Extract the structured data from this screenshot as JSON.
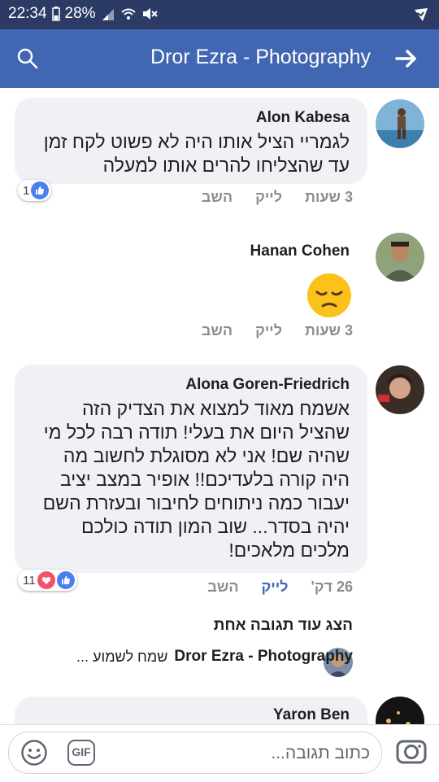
{
  "status_bar": {
    "time": "22:34",
    "battery": "28%"
  },
  "header": {
    "title": "Dror Ezra - Photography"
  },
  "comments": [
    {
      "author": "Alon Kabesa",
      "lines": [
        "לגמריי הציל אותו היה לא פשוט לקח זמן",
        "עד שהצליחו להרים אותו למעלה"
      ],
      "time": "3 שעות",
      "like_label": "לייק",
      "reply_label": "השב",
      "reaction_count": "1"
    },
    {
      "author": "Hanan Cohen",
      "emoji": "😔",
      "time": "3 שעות",
      "like_label": "לייק",
      "reply_label": "השב"
    },
    {
      "author": "Alona Goren-Friedrich",
      "lines": [
        "אשמח מאוד למצוא את הצדיק הזה",
        "שהציל היום את בעלי! תודה רבה לכל מי",
        "שהיה שם! אני לא מסוגלת לחשוב מה",
        "היה קורה בלעדיכם!! אופיר במצב יציב",
        "יעבור כמה ניתוחים לחיבור ובעזרת השם",
        "יהיה בסדר... שוב המון תודה כולכם",
        "מלכים מלאכים!"
      ],
      "time": "26 דק'",
      "like_label": "לייק",
      "reply_label": "השב",
      "reaction_count": "11"
    },
    {
      "author": "Yaron Ben"
    }
  ],
  "more_replies_label": "הצג עוד תגובה אחת",
  "reply_preview": {
    "author": "Dror Ezra - Photography",
    "text": "שמח לשמוע ..."
  },
  "composer": {
    "placeholder": "כתוב תגובה...",
    "gif_label": "GIF"
  },
  "colors": {
    "brand": "#4267b2",
    "status_bar": "#2b3b66",
    "bubble": "#f0f1f4",
    "like": "#4b7ff0",
    "heart": "#f25268"
  }
}
